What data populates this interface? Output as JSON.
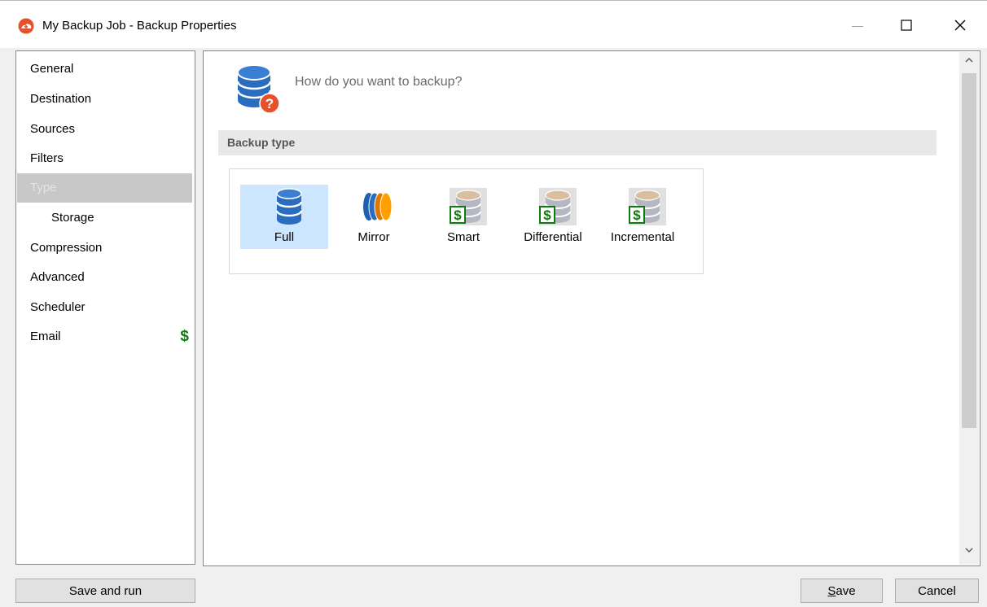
{
  "window": {
    "title": "My Backup Job - Backup Properties",
    "minimize_glyph": "—",
    "maximize_glyph": "☐",
    "close_glyph": "✕"
  },
  "nav": {
    "items": [
      {
        "label": "General"
      },
      {
        "label": "Destination"
      },
      {
        "label": "Sources"
      },
      {
        "label": "Filters"
      },
      {
        "label": "Type",
        "selected": true
      },
      {
        "label": "Storage",
        "sub": true
      },
      {
        "label": "Compression"
      },
      {
        "label": "Advanced"
      },
      {
        "label": "Scheduler"
      },
      {
        "label": "Email",
        "badge": "$"
      }
    ]
  },
  "content": {
    "question": "How do you want to backup?",
    "section_label": "Backup type",
    "types": [
      {
        "label": "Full",
        "icon": "database-icon",
        "selected": true
      },
      {
        "label": "Mirror",
        "icon": "mirror-discs-icon"
      },
      {
        "label": "Smart",
        "icon": "paid-database-icon"
      },
      {
        "label": "Differential",
        "icon": "paid-database-icon"
      },
      {
        "label": "Incremental",
        "icon": "paid-database-icon"
      }
    ],
    "scroll_up_glyph": "︿",
    "scroll_down_glyph": "﹀"
  },
  "buttons": {
    "save_and_run": "Save and run",
    "save_underline": "S",
    "save_rest": "ave",
    "cancel": "Cancel"
  },
  "colors": {
    "selection": "#cce6ff",
    "nav_selected": "#c8c8c8",
    "paid_badge": "#0f7a0f",
    "brand": "#e8502a"
  }
}
